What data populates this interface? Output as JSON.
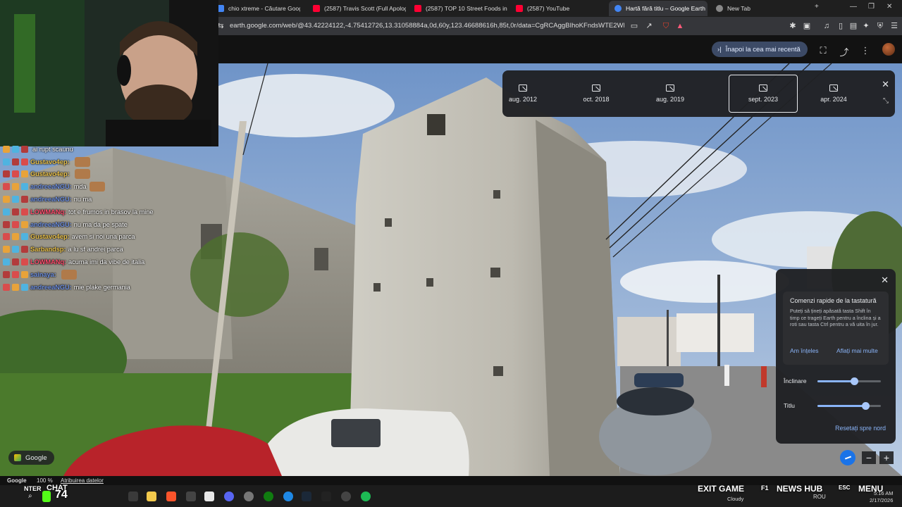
{
  "browser": {
    "tabs": [
      {
        "label": "chio xtreme - Căutare Google",
        "icon_color": "#4285f4",
        "active": false
      },
      {
        "label": "(2587) Travis Scott (Full Apology)",
        "icon_color": "#ff0033",
        "active": false
      },
      {
        "label": "(2587) TOP 10 Street Foods in HA",
        "icon_color": "#ff0033",
        "active": false
      },
      {
        "label": "(2587) YouTube",
        "icon_color": "#ff0033",
        "active": false
      },
      {
        "label": "Hartă fără titlu – Google Earth",
        "icon_color": "#4285f4",
        "active": true
      },
      {
        "label": "New Tab",
        "icon_color": "#888888",
        "active": false
      }
    ],
    "url": "earth.google.com/web/@43.42224122,-4.75412726,13.31058884a,0d,60y,123.46688616h,85t,0r/data=CgRCAggBIhoKFndsWTE2WFJsYVByeVI1el..."
  },
  "earth": {
    "back_to_recent": "Înapoi la cea mai recentă",
    "timeline": {
      "dates": [
        "aug. 2012",
        "oct. 2018",
        "aug. 2019",
        "sept. 2023",
        "apr. 2024"
      ],
      "selected": "sept. 2023"
    },
    "shortcuts": {
      "title": "Comenzi rapide de la tastatură",
      "text": "Puteți să țineți apăsată tasta Shift în timp ce trageți Earth pentru a înclina și a roti sau tasta Ctrl pentru a vă uita în jur.",
      "got_it": "Am înțeles",
      "learn_more": "Aflați mai multe",
      "tilt_label": "Înclinare",
      "tilt_value": 0.58,
      "heading_label": "Titlu",
      "heading_value": 0.76,
      "reset_north": "Resetați spre nord"
    },
    "google_chip": "Google",
    "status": {
      "brand": "Google",
      "zoom": "100 %",
      "attribution": "Atribuirea datelor"
    }
  },
  "chat": [
    {
      "user": "",
      "color": "#e8c04a",
      "msg": "ai rupt scaunu",
      "emote": false
    },
    {
      "user": "Gustavo4ep:",
      "color": "#e8c04a",
      "msg": "",
      "emote": true
    },
    {
      "user": "Gustavo4ep:",
      "color": "#e8c04a",
      "msg": "",
      "emote": true
    },
    {
      "user": "andreeaNGU:",
      "color": "#6d8fe0",
      "msg": "mda",
      "emote": true
    },
    {
      "user": "andreeaNGU:",
      "color": "#6d8fe0",
      "msg": "nu ma",
      "emote": false
    },
    {
      "user": "LOWMANq:",
      "color": "#ff4d6d",
      "msg": "tot e frumos in brasov la mine",
      "emote": false
    },
    {
      "user": "andreeaNGU:",
      "color": "#6d8fe0",
      "msg": "nu ma da pe spate",
      "emote": false
    },
    {
      "user": "Gustavo4ep:",
      "color": "#e8c04a",
      "msg": "avem si noi una parca",
      "emote": false
    },
    {
      "user": "Sarbandsp:",
      "color": "#e8c04a",
      "msg": "a lu sf andrei parca",
      "emote": false
    },
    {
      "user": "LOWMANq:",
      "color": "#ff4d6d",
      "msg": "acuma imi da vibe de italia",
      "emote": false
    },
    {
      "user": "sainaya:",
      "color": "#6d8fe0",
      "msg": "",
      "emote": true
    },
    {
      "user": "andreeaNGU:",
      "color": "#6d8fe0",
      "msg": "mie plake germania",
      "emote": false
    }
  ],
  "stream": {
    "left_text": "NTER",
    "chat_label": "CHAT",
    "viewer_count": "74",
    "exit_game": "EXIT GAME",
    "f1": "F1",
    "news_hub": "NEWS HUB",
    "esc": "ESC",
    "menu": "MENU",
    "weather": "Cloudy",
    "lang": "ROU",
    "time": "5:16 AM",
    "date": "2/17/2026"
  }
}
